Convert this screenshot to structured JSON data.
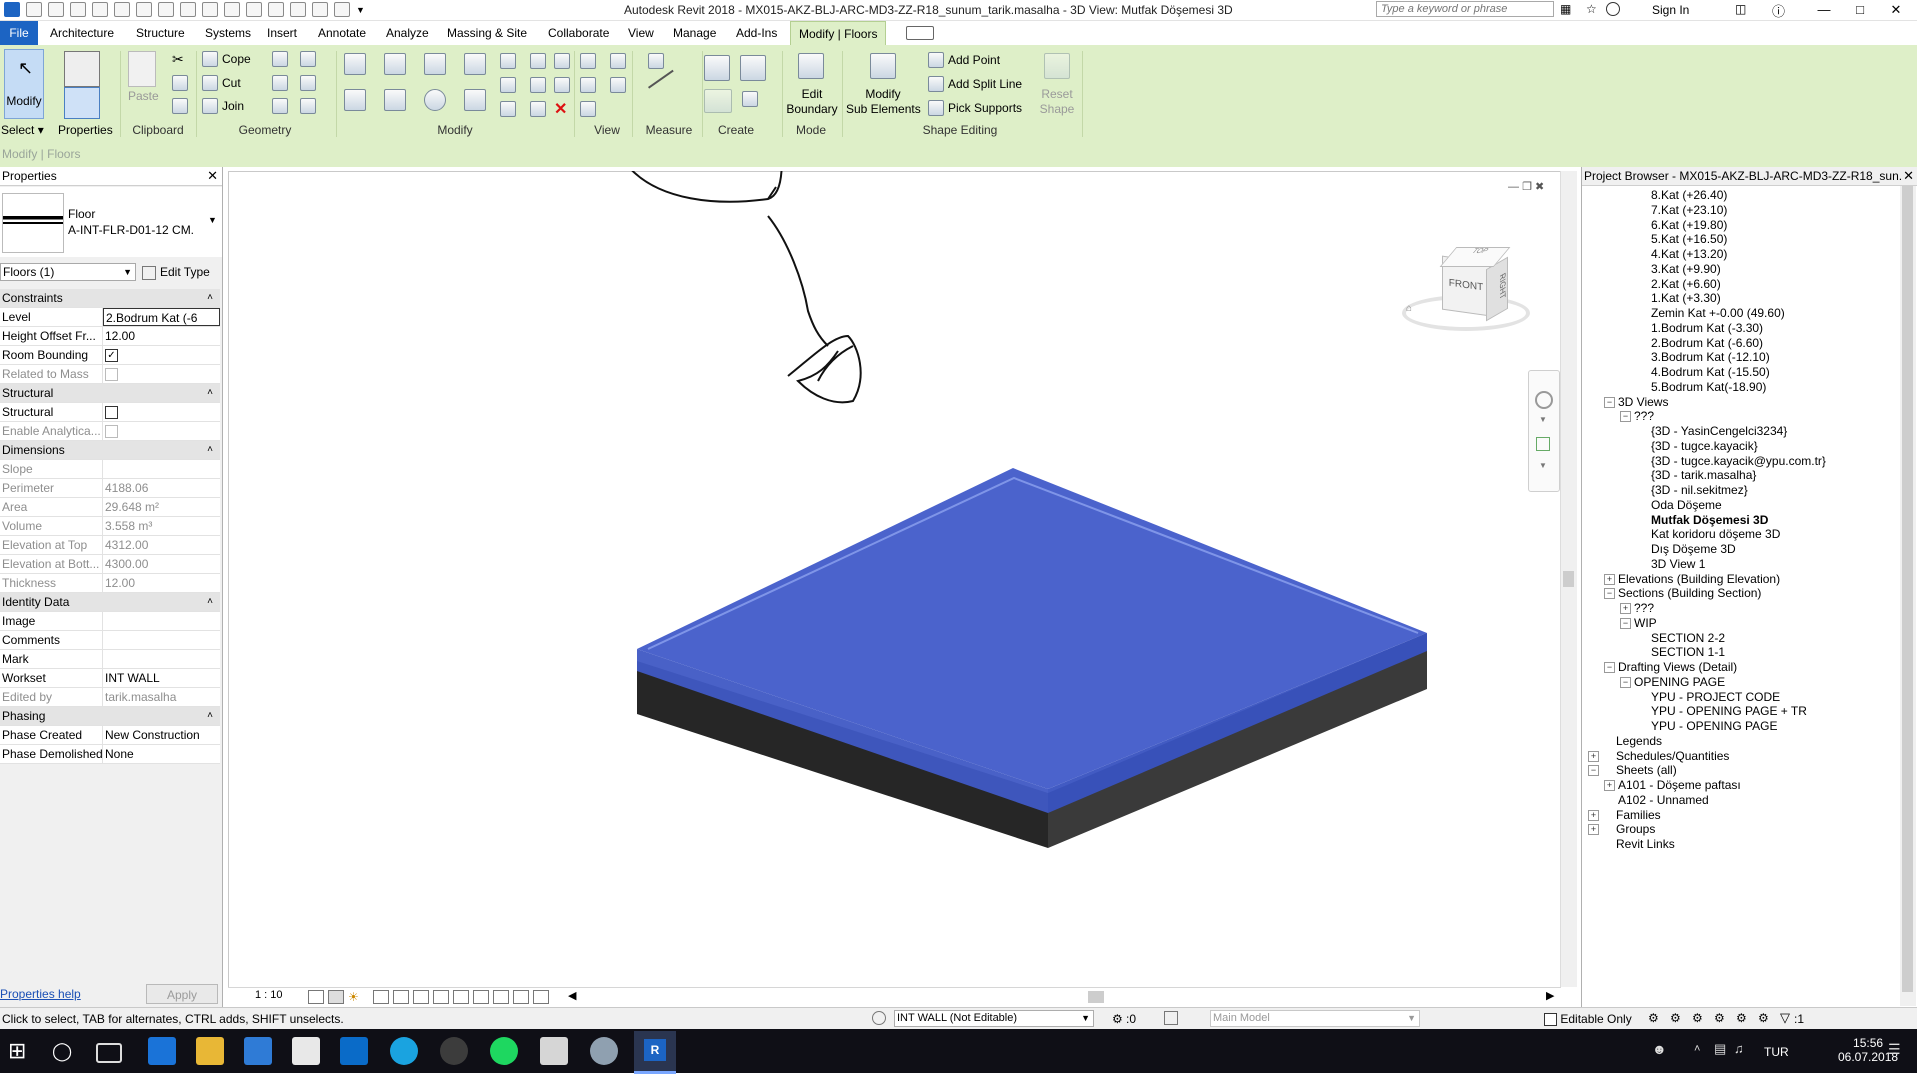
{
  "titlebar": {
    "title": "Autodesk Revit 2018 -     MX015-AKZ-BLJ-ARC-MD3-ZZ-R18_sunum_tarik.masalha - 3D View: Mutfak Döşemesi 3D",
    "search_placeholder": "Type a keyword or phrase",
    "signin": "Sign In"
  },
  "menu": {
    "file": "File",
    "tabs": [
      "Architecture",
      "Structure",
      "Systems",
      "Insert",
      "Annotate",
      "Analyze",
      "Massing & Site",
      "Collaborate",
      "View",
      "Manage",
      "Add-Ins",
      "Modify | Floors"
    ]
  },
  "ribbon": {
    "modify_label": "Modify",
    "select_label": "Select",
    "properties_label": "Properties",
    "paste_label": "Paste",
    "cope_label": "Cope",
    "cut_label": "Cut",
    "join_label": "Join",
    "panels": [
      "Clipboard",
      "Geometry",
      "Modify",
      "View",
      "Measure",
      "Create",
      "Mode",
      "Shape Editing"
    ],
    "edit_boundary": [
      "Edit",
      "Boundary"
    ],
    "modify_sub": [
      "Modify",
      "Sub Elements"
    ],
    "add_point": "Add Point",
    "add_split_line": "Add Split Line",
    "pick_supports": "Pick Supports",
    "reset_shape": [
      "Reset",
      "Shape"
    ],
    "context": "Modify | Floors"
  },
  "properties": {
    "title": "Properties",
    "type_family": "Floor",
    "type_name": "A-INT-FLR-D01-12 CM.",
    "instance_filter": "Floors (1)",
    "edit_type": "Edit Type",
    "help": "Properties help",
    "apply": "Apply",
    "rows": [
      {
        "k": "Constraints",
        "section": true
      },
      {
        "k": "Level",
        "v": "2.Bodrum Kat (-6"
      },
      {
        "k": "Height Offset Fr...",
        "v": "12.00"
      },
      {
        "k": "Room Bounding",
        "v": "",
        "check": true
      },
      {
        "k": "Related to Mass",
        "v": "",
        "dis": true,
        "check": false
      },
      {
        "k": "Structural",
        "section": true
      },
      {
        "k": "Structural",
        "v": "",
        "check": false
      },
      {
        "k": "Enable Analytica...",
        "v": "",
        "dis": true,
        "check": false
      },
      {
        "k": "Dimensions",
        "section": true
      },
      {
        "k": "Slope",
        "v": "",
        "dis": true
      },
      {
        "k": "Perimeter",
        "v": "4188.06",
        "dis": true
      },
      {
        "k": "Area",
        "v": "29.648 m²",
        "dis": true
      },
      {
        "k": "Volume",
        "v": "3.558 m³",
        "dis": true
      },
      {
        "k": "Elevation at Top",
        "v": "4312.00",
        "dis": true
      },
      {
        "k": "Elevation at Bott...",
        "v": "4300.00",
        "dis": true
      },
      {
        "k": "Thickness",
        "v": "12.00",
        "dis": true
      },
      {
        "k": "Identity Data",
        "section": true
      },
      {
        "k": "Image",
        "v": ""
      },
      {
        "k": "Comments",
        "v": ""
      },
      {
        "k": "Mark",
        "v": ""
      },
      {
        "k": "Workset",
        "v": "INT WALL"
      },
      {
        "k": "Edited by",
        "v": "tarik.masalha",
        "dis": true
      },
      {
        "k": "Phasing",
        "section": true
      },
      {
        "k": "Phase Created",
        "v": "New Construction"
      },
      {
        "k": "Phase Demolished",
        "v": "None"
      }
    ]
  },
  "viewcube": {
    "front": "FRONT",
    "right": "RIGHT",
    "top": "TOP"
  },
  "view_scale": "1 : 10",
  "browser": {
    "title": "Project Browser - MX015-AKZ-BLJ-ARC-MD3-ZZ-R18_sun...",
    "items": [
      {
        "t": "8.Kat (+26.40)",
        "lvl": 4
      },
      {
        "t": "7.Kat (+23.10)",
        "lvl": 4
      },
      {
        "t": "6.Kat (+19.80)",
        "lvl": 4
      },
      {
        "t": "5.Kat (+16.50)",
        "lvl": 4
      },
      {
        "t": "4.Kat (+13.20)",
        "lvl": 4
      },
      {
        "t": "3.Kat (+9.90)",
        "lvl": 4
      },
      {
        "t": "2.Kat (+6.60)",
        "lvl": 4
      },
      {
        "t": "1.Kat (+3.30)",
        "lvl": 4
      },
      {
        "t": "Zemin Kat +-0.00 (49.60)",
        "lvl": 4
      },
      {
        "t": "1.Bodrum Kat  (-3.30)",
        "lvl": 4
      },
      {
        "t": "2.Bodrum Kat (-6.60)",
        "lvl": 4
      },
      {
        "t": "3.Bodrum Kat (-12.10)",
        "lvl": 4
      },
      {
        "t": "4.Bodrum Kat (-15.50)",
        "lvl": 4
      },
      {
        "t": "5.Bodrum Kat(-18.90)",
        "lvl": 4
      },
      {
        "t": "3D Views",
        "lvl": 2,
        "exp": "-"
      },
      {
        "t": "???",
        "lvl": 3,
        "exp": "-"
      },
      {
        "t": "{3D - YasinCengelci3234}",
        "lvl": 4
      },
      {
        "t": "{3D - tugce.kayacik}",
        "lvl": 4
      },
      {
        "t": "{3D - tugce.kayacik@ypu.com.tr}",
        "lvl": 4
      },
      {
        "t": "{3D - tarik.masalha}",
        "lvl": 4
      },
      {
        "t": "{3D - nil.sekitmez}",
        "lvl": 4
      },
      {
        "t": "Oda Döşeme",
        "lvl": 4
      },
      {
        "t": "Mutfak Döşemesi 3D",
        "lvl": 4,
        "sel": true
      },
      {
        "t": "Kat koridoru döşeme 3D",
        "lvl": 4
      },
      {
        "t": "Dış Döşeme 3D",
        "lvl": 4
      },
      {
        "t": "3D View 1",
        "lvl": 4
      },
      {
        "t": "Elevations (Building Elevation)",
        "lvl": 2,
        "exp": "+"
      },
      {
        "t": "Sections (Building Section)",
        "lvl": 2,
        "exp": "-"
      },
      {
        "t": "???",
        "lvl": 3,
        "exp": "+"
      },
      {
        "t": "WIP",
        "lvl": 3,
        "exp": "-"
      },
      {
        "t": "SECTION 2-2",
        "lvl": 4
      },
      {
        "t": "SECTION 1-1",
        "lvl": 4
      },
      {
        "t": "Drafting Views (Detail)",
        "lvl": 2,
        "exp": "-"
      },
      {
        "t": "OPENING PAGE",
        "lvl": 3,
        "exp": "-"
      },
      {
        "t": "YPU - PROJECT CODE",
        "lvl": 4
      },
      {
        "t": "YPU - OPENING PAGE + TR",
        "lvl": 4
      },
      {
        "t": "YPU - OPENING PAGE",
        "lvl": 4
      },
      {
        "t": "Legends",
        "lvl": 1
      },
      {
        "t": "Schedules/Quantities",
        "lvl": 1,
        "exp": "+"
      },
      {
        "t": "Sheets (all)",
        "lvl": 1,
        "exp": "-"
      },
      {
        "t": "A101 - Döşeme paftası",
        "lvl": 2,
        "exp": "+"
      },
      {
        "t": "A102 - Unnamed",
        "lvl": 2
      },
      {
        "t": "Families",
        "lvl": 1,
        "exp": "+"
      },
      {
        "t": "Groups",
        "lvl": 1,
        "exp": "+"
      },
      {
        "t": "Revit Links",
        "lvl": 1
      }
    ]
  },
  "status": {
    "hint": "Click to select, TAB for alternates, CTRL adds, SHIFT unselects.",
    "workset": "INT WALL (Not Editable)",
    "zero": ":0",
    "model": "Main Model",
    "editable_only": "Editable Only",
    "filter": ":1"
  },
  "tray": {
    "lang": "TUR",
    "time": "15:56",
    "date": "06.07.2018"
  },
  "colors": {
    "floor_top": "#4a62c8",
    "floor_side": "#3a3a3a",
    "ribbon": "#deefc8",
    "file_tab": "#1c64c3"
  }
}
